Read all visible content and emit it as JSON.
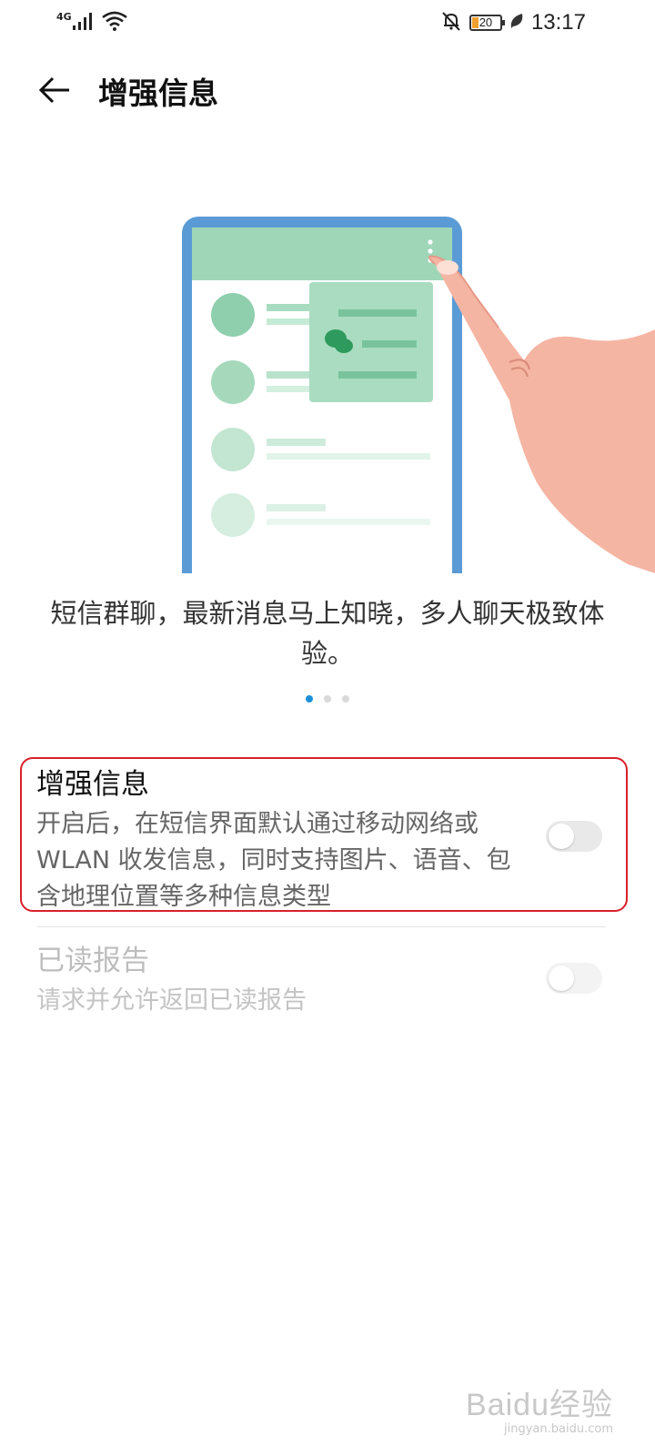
{
  "status_bar": {
    "network": "4G",
    "battery": "20",
    "time": "13:17",
    "icons": [
      "signal-icon",
      "wifi-icon",
      "mute-bell-icon",
      "battery-icon",
      "leaf-icon"
    ]
  },
  "header": {
    "back_icon": "arrow-left-icon",
    "title": "增强信息"
  },
  "intro": {
    "caption": "短信群聊，最新消息马上知晓，多人聊天极致体验。",
    "page_count": 3,
    "active_page": 1
  },
  "settings": [
    {
      "title": "增强信息",
      "description": "开启后，在短信界面默认通过移动网络或 WLAN 收发信息，同时支持图片、语音、包含地理位置等多种信息类型",
      "enabled": false,
      "disabled": false
    },
    {
      "title": "已读报告",
      "description": "请求并允许返回已读报告",
      "enabled": false,
      "disabled": true
    }
  ],
  "colors": {
    "accent": "#1e90d8",
    "highlight_border": "#d8202a",
    "illustration_green": "#8fcfad",
    "phone_frame": "#5b9bd5"
  },
  "watermark": {
    "logo": "Baidu经验",
    "url": "jingyan.baidu.com"
  }
}
